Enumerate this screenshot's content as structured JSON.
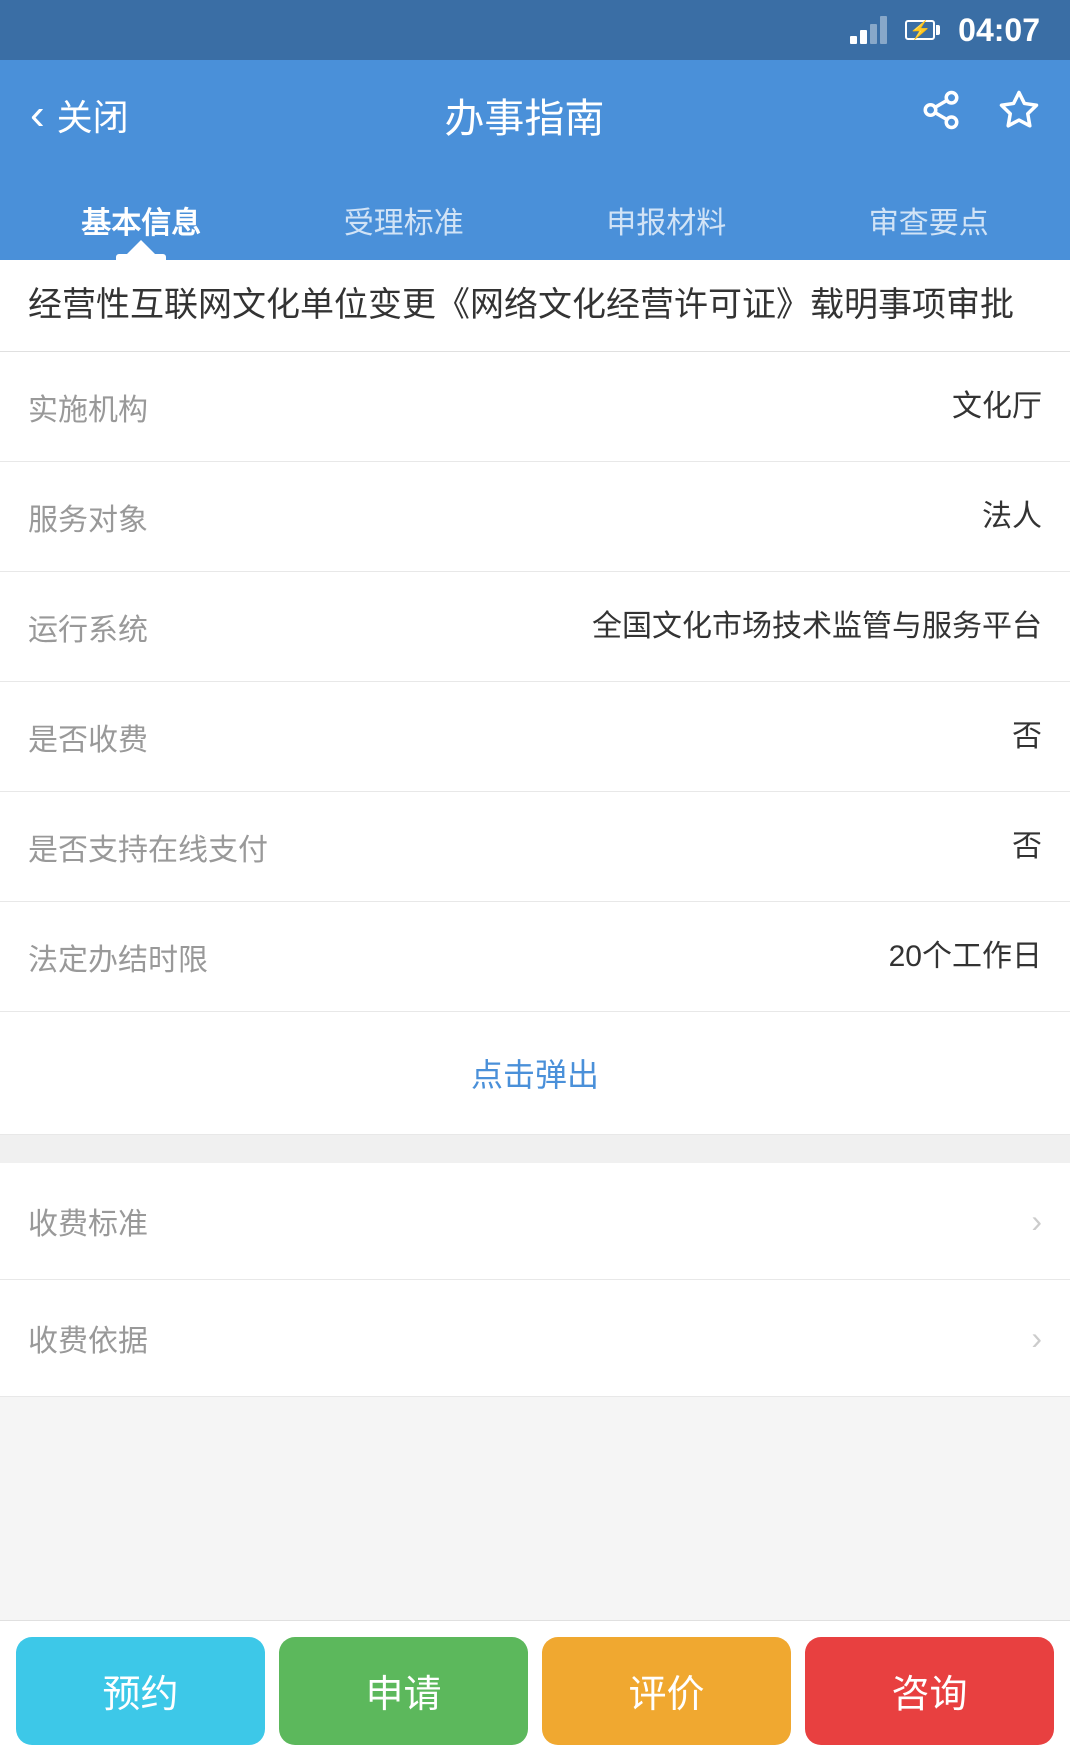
{
  "statusBar": {
    "time": "04:07"
  },
  "navBar": {
    "backLabel": "关闭",
    "title": "办事指南",
    "shareIconUnicode": "⇧",
    "starIconUnicode": "☆"
  },
  "tabs": [
    {
      "id": "basic",
      "label": "基本信息",
      "active": true
    },
    {
      "id": "standard",
      "label": "受理标准",
      "active": false
    },
    {
      "id": "materials",
      "label": "申报材料",
      "active": false
    },
    {
      "id": "review",
      "label": "审查要点",
      "active": false
    }
  ],
  "pageTitle": "经营性互联网文化单位变更《网络文化经营许可证》载明事项审批",
  "infoRows": [
    {
      "label": "实施机构",
      "value": "文化厅"
    },
    {
      "label": "服务对象",
      "value": "法人"
    },
    {
      "label": "运行系统",
      "value": "全国文化市场技术监管与服务平台"
    },
    {
      "label": "是否收费",
      "value": "否"
    },
    {
      "label": "是否支持在线支付",
      "value": "否"
    },
    {
      "label": "法定办结时限",
      "value": "20个工作日"
    }
  ],
  "clickPopup": {
    "label": "点击弹出"
  },
  "expandRows": [
    {
      "label": "收费标准"
    },
    {
      "label": "收费依据"
    }
  ],
  "bottomButtons": [
    {
      "id": "book",
      "label": "预约"
    },
    {
      "id": "apply",
      "label": "申请"
    },
    {
      "id": "review-btn",
      "label": "评价"
    },
    {
      "id": "consult",
      "label": "咨询"
    }
  ]
}
